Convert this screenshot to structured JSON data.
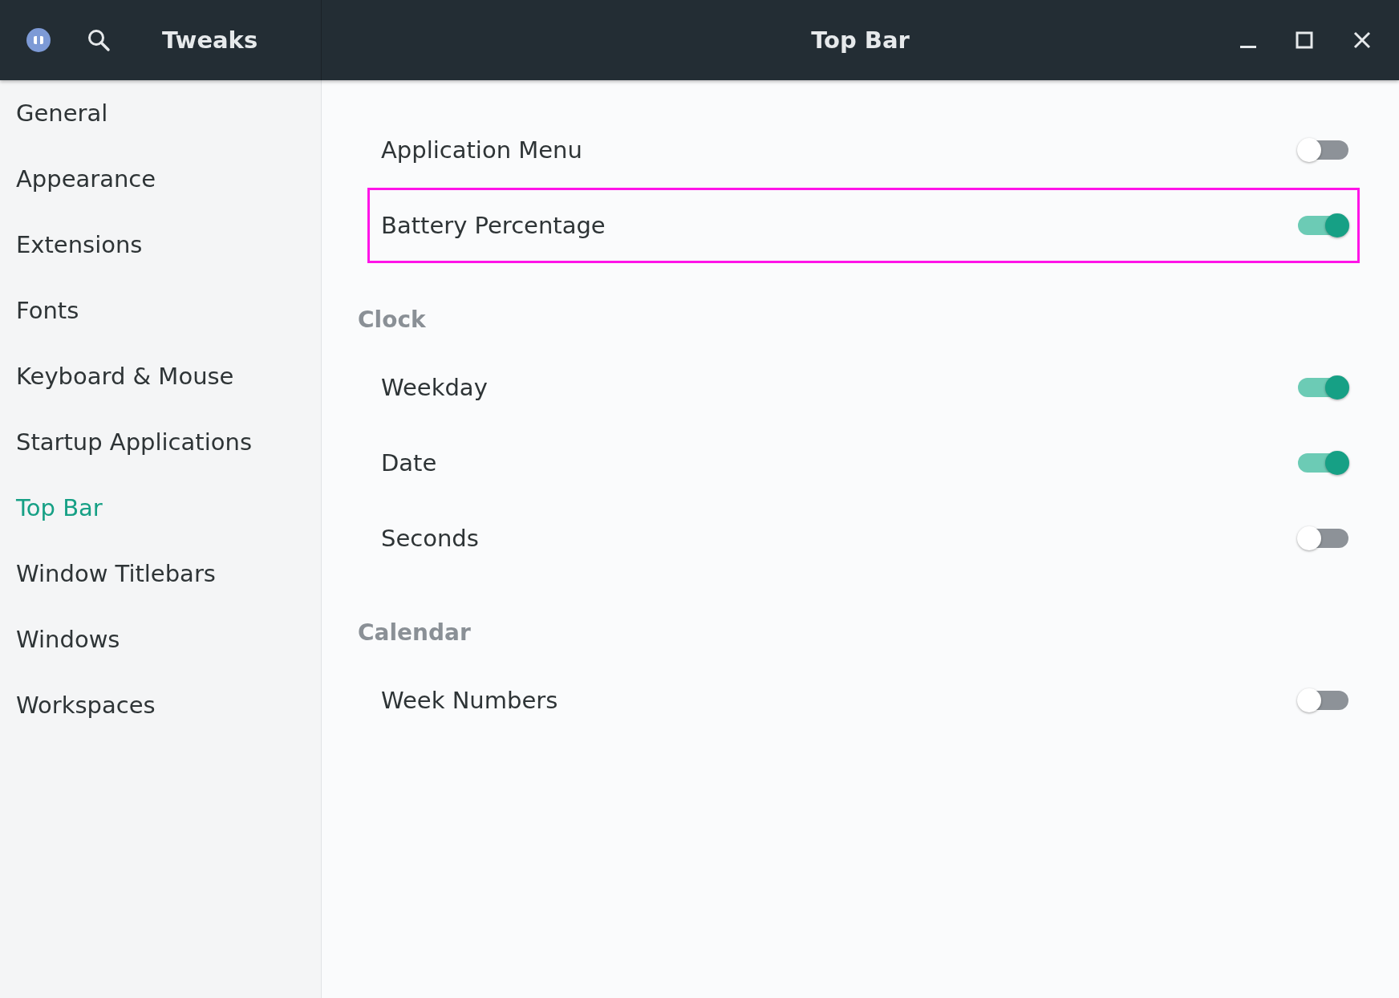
{
  "header": {
    "app_title": "Tweaks",
    "page_title": "Top Bar"
  },
  "sidebar": {
    "items": [
      {
        "label": "General",
        "selected": false
      },
      {
        "label": "Appearance",
        "selected": false
      },
      {
        "label": "Extensions",
        "selected": false
      },
      {
        "label": "Fonts",
        "selected": false
      },
      {
        "label": "Keyboard & Mouse",
        "selected": false
      },
      {
        "label": "Startup Applications",
        "selected": false
      },
      {
        "label": "Top Bar",
        "selected": true
      },
      {
        "label": "Window Titlebars",
        "selected": false
      },
      {
        "label": "Windows",
        "selected": false
      },
      {
        "label": "Workspaces",
        "selected": false
      }
    ]
  },
  "sections": [
    {
      "rows": [
        {
          "label": "Application Menu",
          "on": false,
          "highlighted": false
        },
        {
          "label": "Battery Percentage",
          "on": true,
          "highlighted": true
        }
      ]
    },
    {
      "heading": "Clock",
      "rows": [
        {
          "label": "Weekday",
          "on": true,
          "highlighted": false
        },
        {
          "label": "Date",
          "on": true,
          "highlighted": false
        },
        {
          "label": "Seconds",
          "on": false,
          "highlighted": false
        }
      ]
    },
    {
      "heading": "Calendar",
      "rows": [
        {
          "label": "Week Numbers",
          "on": false,
          "highlighted": false
        }
      ]
    }
  ]
}
